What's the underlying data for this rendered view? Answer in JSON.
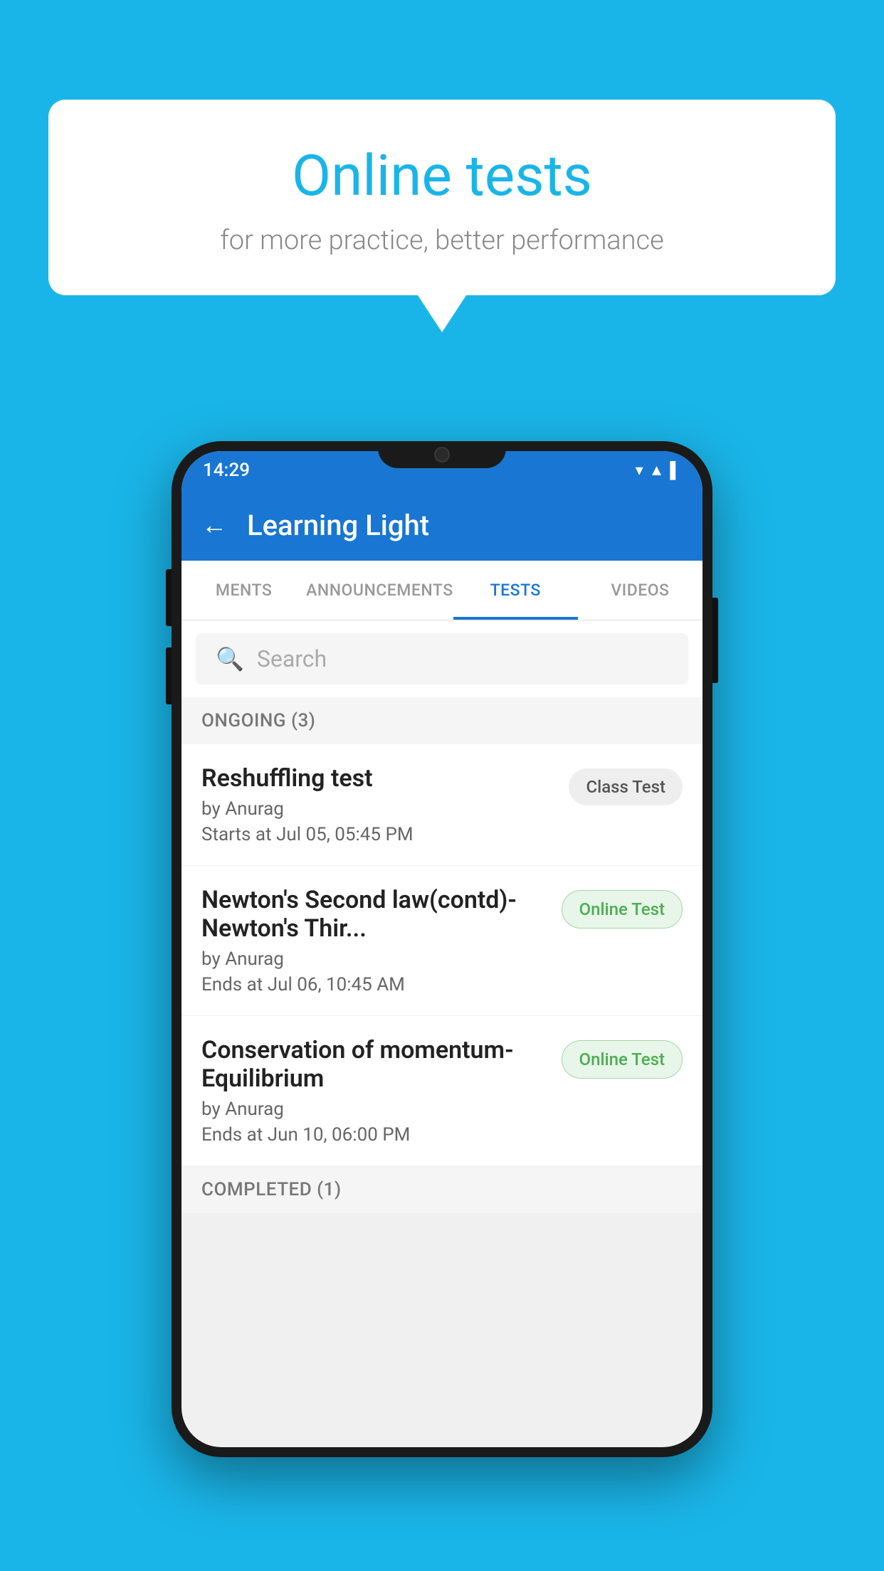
{
  "background": {
    "color": "#1ab5e8"
  },
  "bubble": {
    "title": "Online tests",
    "subtitle": "for more practice, better performance"
  },
  "phone": {
    "status_bar": {
      "time": "14:29",
      "icons": [
        "wifi",
        "signal",
        "battery"
      ]
    },
    "app_bar": {
      "title": "Learning Light",
      "back_label": "←"
    },
    "tabs": [
      {
        "label": "MENTS",
        "active": false
      },
      {
        "label": "ANNOUNCEMENTS",
        "active": false
      },
      {
        "label": "TESTS",
        "active": true
      },
      {
        "label": "VIDEOS",
        "active": false
      }
    ],
    "search": {
      "placeholder": "Search"
    },
    "ongoing_section": {
      "label": "ONGOING (3)"
    },
    "tests": [
      {
        "title": "Reshuffling test",
        "author": "by Anurag",
        "time_label": "Starts at",
        "time": "Jul 05, 05:45 PM",
        "badge": "Class Test",
        "badge_type": "class"
      },
      {
        "title": "Newton's Second law(contd)-Newton's Thir...",
        "author": "by Anurag",
        "time_label": "Ends at",
        "time": "Jul 06, 10:45 AM",
        "badge": "Online Test",
        "badge_type": "online"
      },
      {
        "title": "Conservation of momentum-Equilibrium",
        "author": "by Anurag",
        "time_label": "Ends at",
        "time": "Jun 10, 06:00 PM",
        "badge": "Online Test",
        "badge_type": "online"
      }
    ],
    "completed_section": {
      "label": "COMPLETED (1)"
    }
  }
}
